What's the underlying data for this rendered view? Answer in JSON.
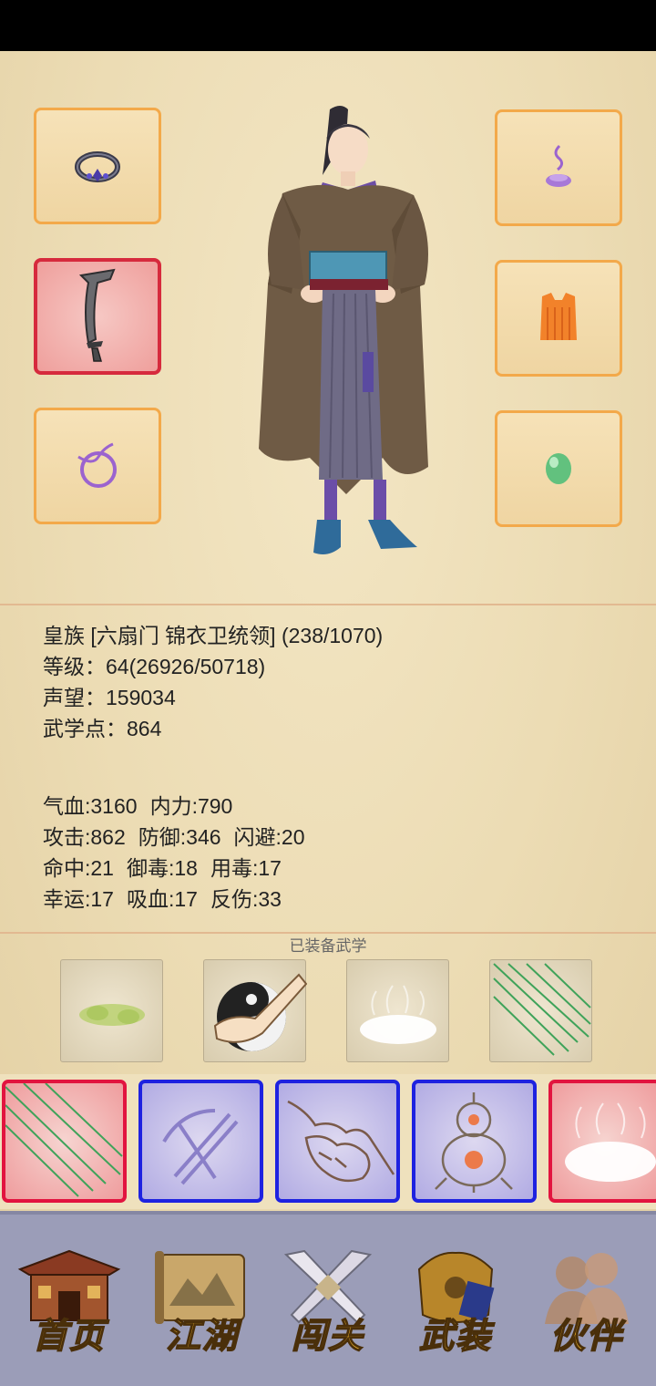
{
  "character": {
    "faction_line": "皇族 [六扇门 锦衣卫统领] (238/1070)",
    "level_line": "等级：64(26926/50718)",
    "fame_line": "声望：159034",
    "points_line": "武学点：864"
  },
  "stats": [
    [
      "气血:3160",
      "内力:790"
    ],
    [
      "攻击:862",
      "防御:346",
      "闪避:20"
    ],
    [
      "命中:21",
      "御毒:18",
      "用毒:17"
    ],
    [
      "幸运:17",
      "吸血:17",
      "反伤:33"
    ]
  ],
  "equipped_skills_title": "已装备武学",
  "nav": [
    {
      "label": "首页",
      "icon": "building-icon"
    },
    {
      "label": "江湖",
      "icon": "scroll-map-icon"
    },
    {
      "label": "闯关",
      "icon": "crossed-swords-icon"
    },
    {
      "label": "武装",
      "icon": "armor-icon"
    },
    {
      "label": "伙伴",
      "icon": "companions-icon"
    }
  ],
  "colors": {
    "slot_border": "#f3a94a",
    "active_red": "#d62a3d",
    "blue_card": "#1e22e0",
    "nav_gold": "#f1b62b"
  }
}
